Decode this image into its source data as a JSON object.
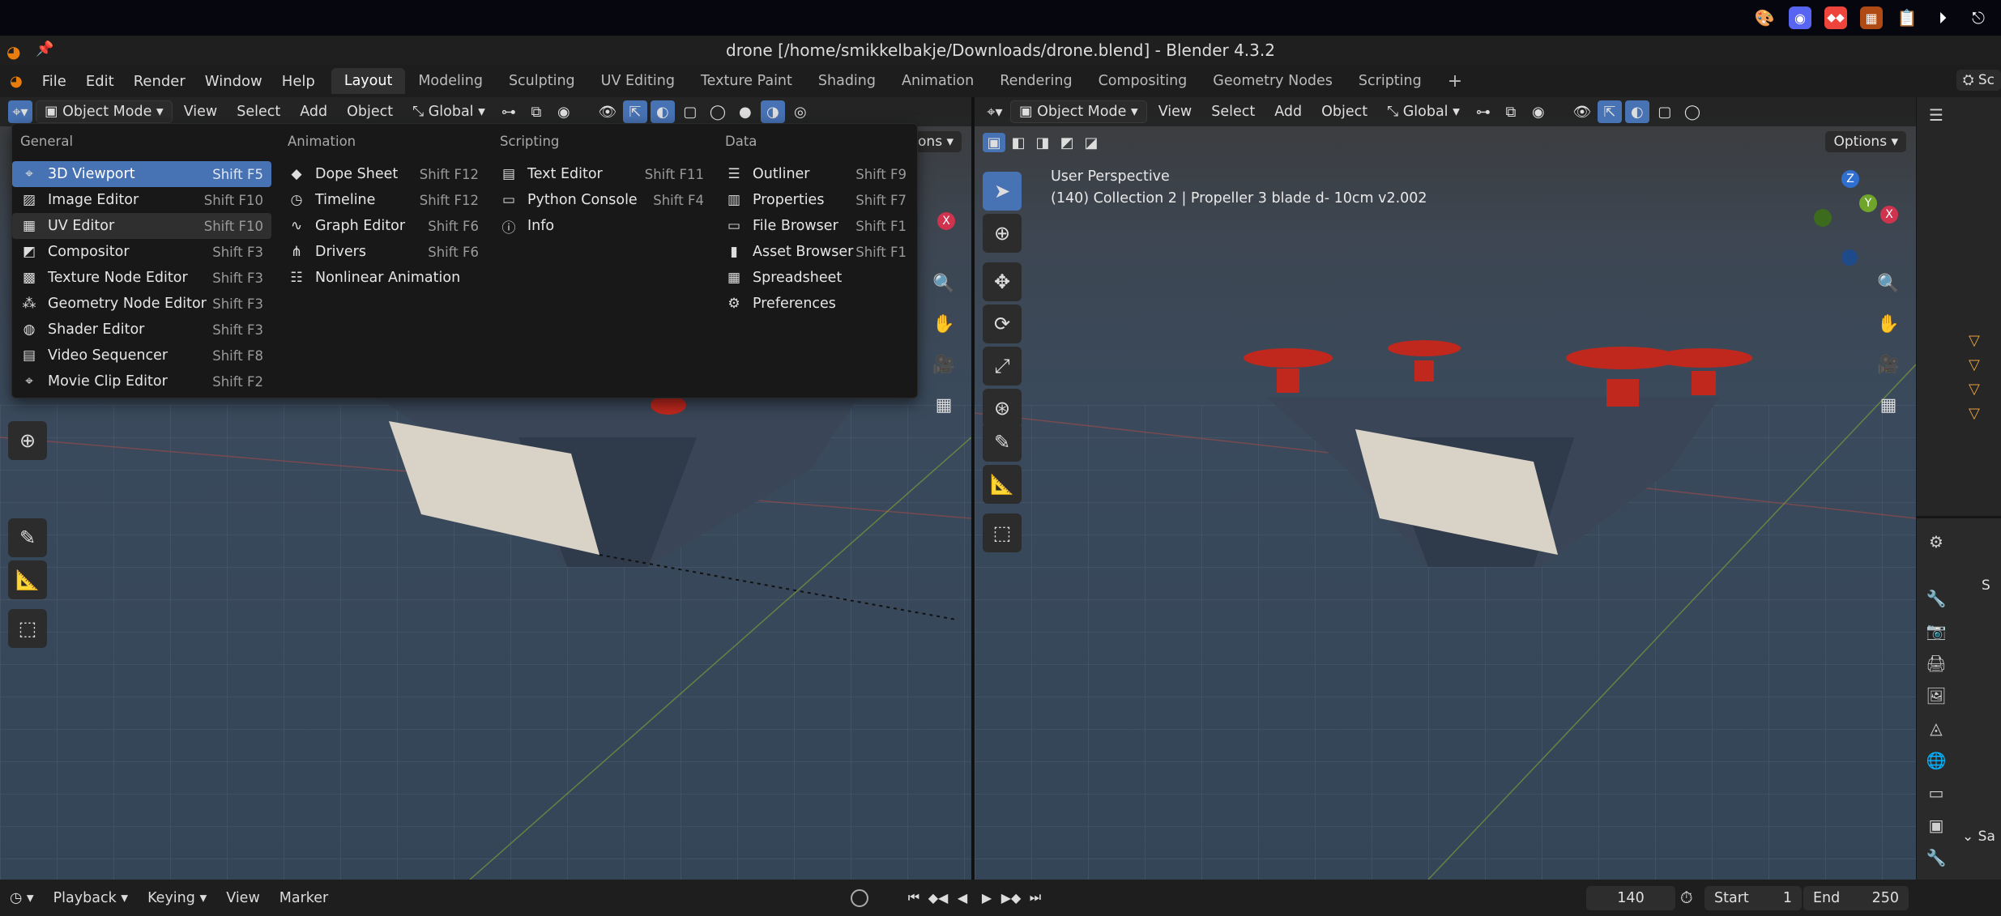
{
  "window": {
    "title": "drone [/home/smikkelbakje/Downloads/drone.blend] - Blender 4.3.2"
  },
  "menu": [
    "File",
    "Edit",
    "Render",
    "Window",
    "Help"
  ],
  "workspaces": [
    "Layout",
    "Modeling",
    "Sculpting",
    "UV Editing",
    "Texture Paint",
    "Shading",
    "Animation",
    "Rendering",
    "Compositing",
    "Geometry Nodes",
    "Scripting"
  ],
  "active_workspace": "Layout",
  "left_viewport": {
    "mode": "Object Mode",
    "menus": [
      "View",
      "Select",
      "Add",
      "Object"
    ],
    "orientation": "Global",
    "options_label": "ptions"
  },
  "right_viewport": {
    "mode": "Object Mode",
    "menus": [
      "View",
      "Select",
      "Add",
      "Object"
    ],
    "orientation": "Global",
    "options_label": "Options",
    "perspective_label": "User Perspective",
    "object_info": "(140) Collection 2 | Propeller 3 blade d- 10cm v2.002",
    "gizmo_z": "Z",
    "gizmo_y": "Y",
    "gizmo_x": "X"
  },
  "editor_menu": {
    "general": {
      "heading": "General",
      "items": [
        {
          "label": "3D Viewport",
          "shortcut": "Shift F5",
          "icon": "viewport-icon"
        },
        {
          "label": "Image Editor",
          "shortcut": "Shift F10",
          "icon": "image-icon"
        },
        {
          "label": "UV Editor",
          "shortcut": "Shift F10",
          "icon": "uv-icon"
        },
        {
          "label": "Compositor",
          "shortcut": "Shift F3",
          "icon": "compositor-icon"
        },
        {
          "label": "Texture Node Editor",
          "shortcut": "Shift F3",
          "icon": "texture-icon"
        },
        {
          "label": "Geometry Node Editor",
          "shortcut": "Shift F3",
          "icon": "geometry-icon"
        },
        {
          "label": "Shader Editor",
          "shortcut": "Shift F3",
          "icon": "shader-icon"
        },
        {
          "label": "Video Sequencer",
          "shortcut": "Shift F8",
          "icon": "sequencer-icon"
        },
        {
          "label": "Movie Clip Editor",
          "shortcut": "Shift F2",
          "icon": "clip-icon"
        }
      ]
    },
    "animation": {
      "heading": "Animation",
      "items": [
        {
          "label": "Dope Sheet",
          "shortcut": "Shift F12",
          "icon": "dopesheet-icon"
        },
        {
          "label": "Timeline",
          "shortcut": "Shift F12",
          "icon": "timeline-icon"
        },
        {
          "label": "Graph Editor",
          "shortcut": "Shift F6",
          "icon": "graph-icon"
        },
        {
          "label": "Drivers",
          "shortcut": "Shift F6",
          "icon": "drivers-icon"
        },
        {
          "label": "Nonlinear Animation",
          "shortcut": "",
          "icon": "nla-icon"
        }
      ]
    },
    "scripting": {
      "heading": "Scripting",
      "items": [
        {
          "label": "Text Editor",
          "shortcut": "Shift F11",
          "icon": "text-icon"
        },
        {
          "label": "Python Console",
          "shortcut": "Shift F4",
          "icon": "console-icon"
        },
        {
          "label": "Info",
          "shortcut": "",
          "icon": "info-icon"
        }
      ]
    },
    "data": {
      "heading": "Data",
      "items": [
        {
          "label": "Outliner",
          "shortcut": "Shift F9",
          "icon": "outliner-icon"
        },
        {
          "label": "Properties",
          "shortcut": "Shift F7",
          "icon": "properties-icon"
        },
        {
          "label": "File Browser",
          "shortcut": "Shift F1",
          "icon": "filebrowser-icon"
        },
        {
          "label": "Asset Browser",
          "shortcut": "Shift F1",
          "icon": "asset-icon"
        },
        {
          "label": "Spreadsheet",
          "shortcut": "",
          "icon": "spreadsheet-icon"
        },
        {
          "label": "Preferences",
          "shortcut": "",
          "icon": "gear-icon"
        }
      ]
    }
  },
  "right_panel": {
    "header_label": "Sc",
    "section_label": "Sa",
    "props_label": "S"
  },
  "timeline": {
    "menus": [
      "Playback",
      "Keying",
      "View",
      "Marker"
    ],
    "current_frame": "140",
    "start_label": "Start",
    "start": "1",
    "end_label": "End",
    "end": "250"
  },
  "colors": {
    "accent": "#4772b3",
    "brand": "#e87d0d",
    "arrow": "#e0201d",
    "propeller": "#c0281e"
  }
}
